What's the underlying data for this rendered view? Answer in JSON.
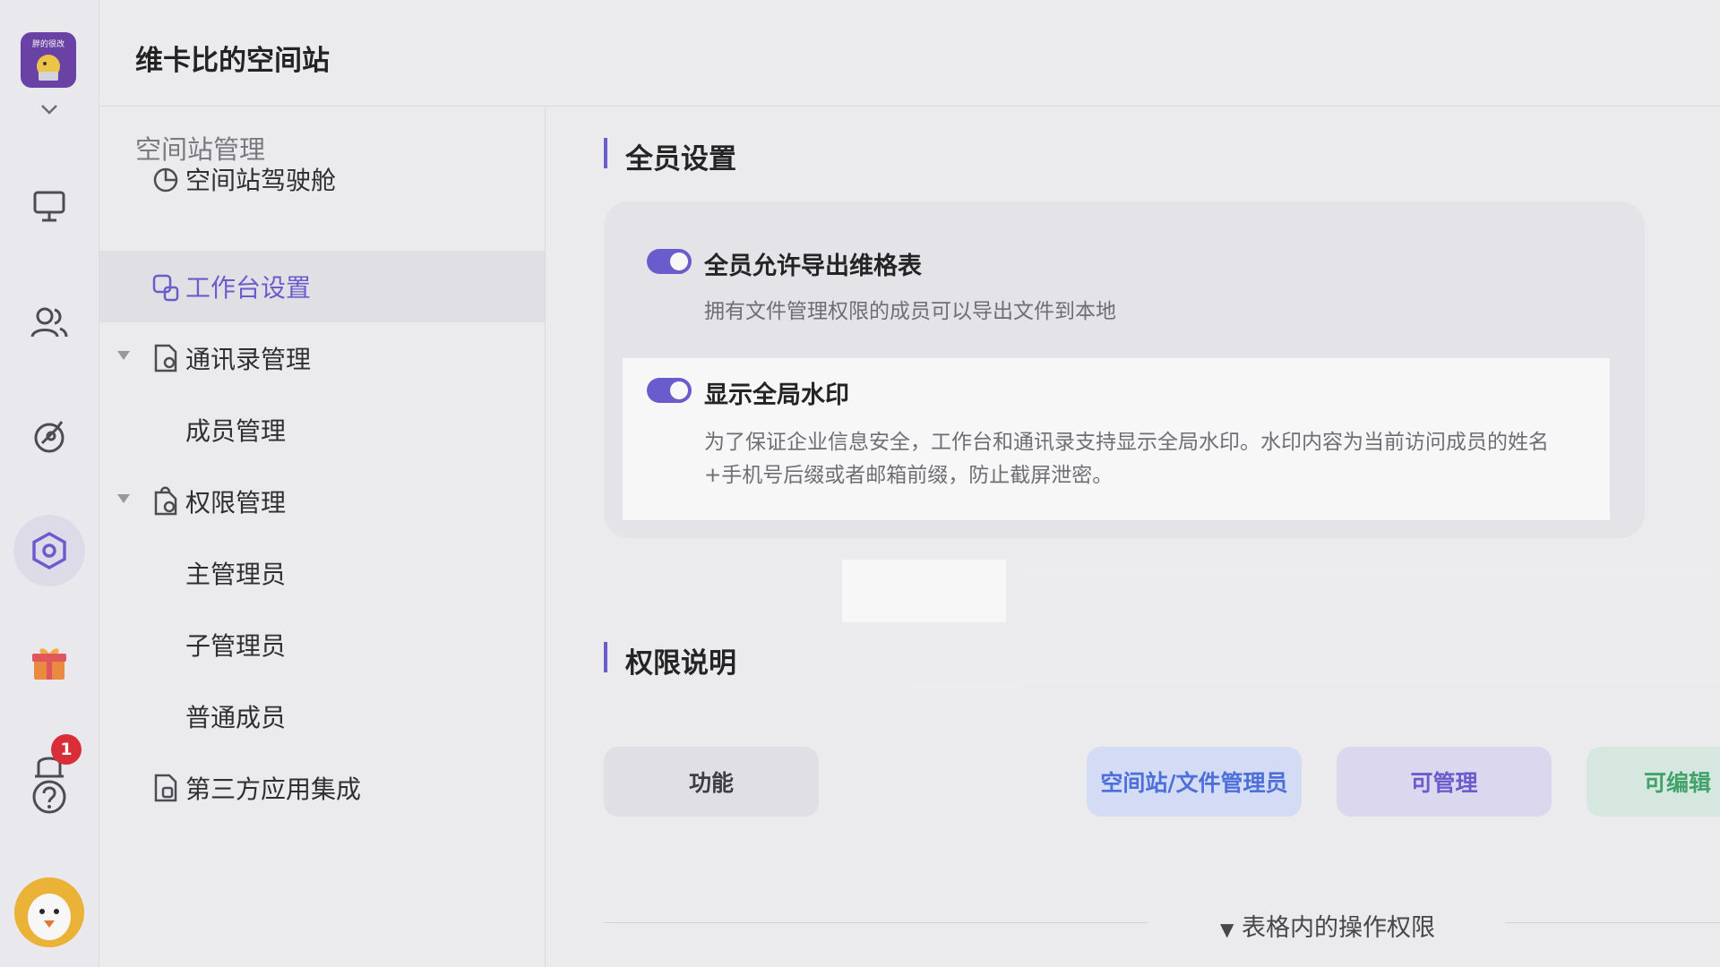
{
  "rail": {
    "logo_text": "胖的很改",
    "notification_count": "1"
  },
  "header": {
    "title": "维卡比的空间站"
  },
  "sidenav": {
    "heading": "空间站管理",
    "items": [
      {
        "label": "空间站驾驶舱",
        "icon": "pie-chart-icon"
      },
      {
        "label": "工作台设置",
        "icon": "workbench-icon",
        "active": true
      },
      {
        "label": "通讯录管理",
        "icon": "contacts-doc-icon",
        "expandable": true
      },
      {
        "label": "成员管理"
      },
      {
        "label": "权限管理",
        "icon": "lock-doc-icon",
        "expandable": true
      },
      {
        "label": "主管理员"
      },
      {
        "label": "子管理员"
      },
      {
        "label": "普通成员"
      },
      {
        "label": "第三方应用集成",
        "icon": "app-doc-icon"
      }
    ]
  },
  "main": {
    "section1_title": "全员设置",
    "settings": [
      {
        "title": "全员允许导出维格表",
        "desc": "拥有文件管理权限的成员可以导出文件到本地",
        "enabled": true
      },
      {
        "title": "显示全局水印",
        "desc_line1": "为了保证企业信息安全，工作台和通讯录支持显示全局水印。水印内容为当前访问成员的姓名",
        "desc_line2": "+手机号后缀或者邮箱前缀，防止截屏泄密。",
        "enabled": true
      }
    ],
    "section2_title": "权限说明",
    "perm_headers": [
      "功能",
      "空间站/文件管理员",
      "可管理",
      "可编辑"
    ],
    "table_perm_label": "表格内的操作权限"
  },
  "colors": {
    "accent": "#6b5bd2",
    "toggle_on": "#6b5bd2",
    "badge": "#e02a33"
  }
}
